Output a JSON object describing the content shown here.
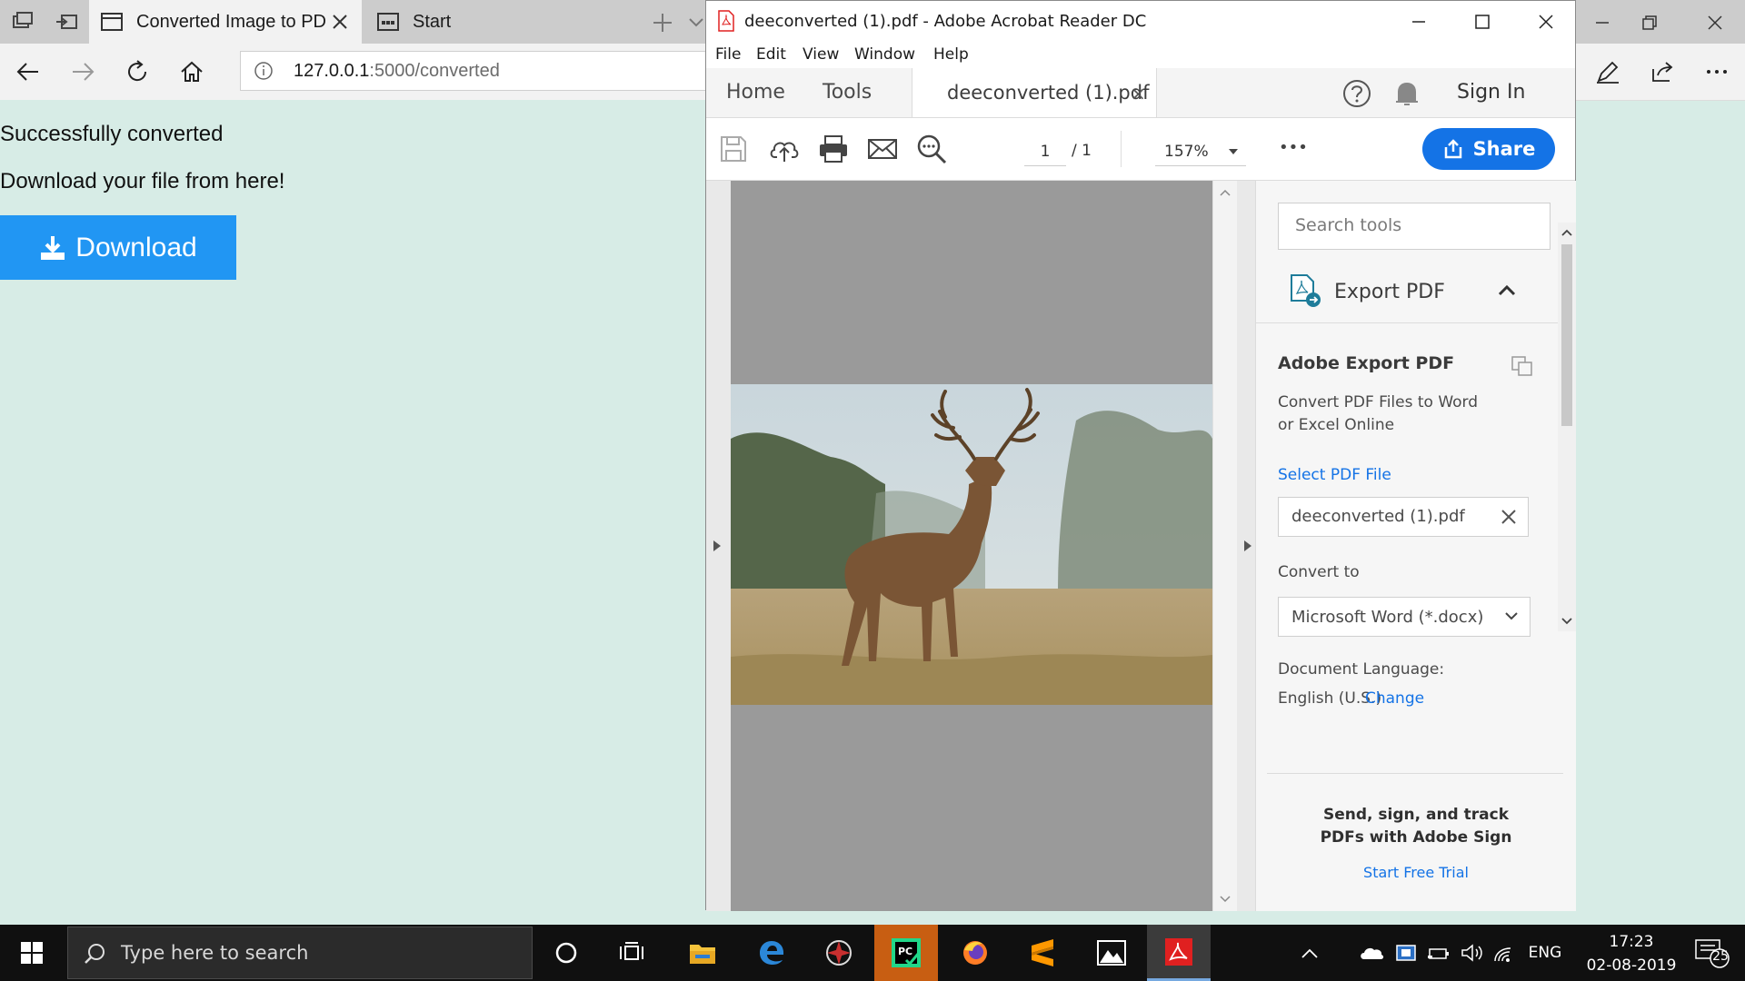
{
  "browser": {
    "tabs": [
      {
        "label": "Converted Image to PD"
      },
      {
        "label": "Start"
      }
    ],
    "address": {
      "host": "127.0.0.1",
      "path": ":5000/converted"
    }
  },
  "page": {
    "line1": "Successfully converted",
    "line2": "Download your file from here!",
    "download_label": "Download"
  },
  "acrobat": {
    "title": "deeconverted (1).pdf - Adobe Acrobat Reader DC",
    "menu": [
      "File",
      "Edit",
      "View",
      "Window",
      "Help"
    ],
    "tabs": {
      "home": "Home",
      "tools": "Tools",
      "document": "deeconverted (1).pdf",
      "close": "×"
    },
    "sign_in": "Sign In",
    "toolbar": {
      "page_current": "1",
      "page_sep": "/ 1",
      "zoom": "157%",
      "more": "•••",
      "share_label": "Share"
    },
    "panel": {
      "search_placeholder": "Search tools",
      "export_title": "Export PDF",
      "adobe_export_title": "Adobe Export PDF",
      "adobe_export_desc": "Convert PDF Files to Word or Excel Online",
      "select_file": "Select PDF File",
      "file_name": "deeconverted (1).pdf",
      "convert_to_label": "Convert to",
      "convert_to_value": "Microsoft Word (*.docx)",
      "doc_language_label": "Document Language:",
      "doc_language_value": "English (U.S.)",
      "doc_language_change": "Change",
      "sign_promo_line1": "Send, sign, and track",
      "sign_promo_line2": "PDFs with Adobe Sign",
      "sign_trial": "Start Free Trial"
    }
  },
  "taskbar": {
    "search_placeholder": "Type here to search",
    "language": "ENG",
    "time": "17:23",
    "date": "02-08-2019",
    "notification_count": "25"
  },
  "colors": {
    "page_bg": "#d7ece6",
    "download_button": "#2196f3",
    "acrobat_blue": "#1473e6",
    "acrobat_red": "#e02020"
  }
}
